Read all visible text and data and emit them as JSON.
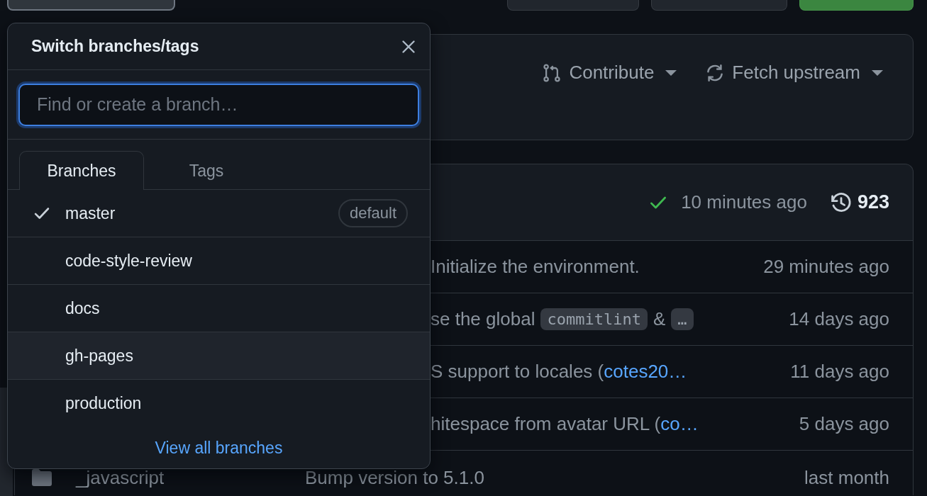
{
  "top_buttons": [
    {
      "kind": "outlined"
    },
    {
      "kind": "default"
    },
    {
      "kind": "default"
    },
    {
      "kind": "primary"
    }
  ],
  "repo_actions": [
    {
      "label": "Contribute",
      "kind": "contribute"
    },
    {
      "label": "Fetch upstream",
      "kind": "fetch"
    }
  ],
  "latest_commit": {
    "checks_passed": true,
    "time": "10 minutes ago",
    "commit_count": "923"
  },
  "files": [
    {
      "message": [
        {
          "kind": "text",
          "text": "Initialize the environment."
        }
      ],
      "time": "29 minutes ago"
    },
    {
      "message": [
        {
          "kind": "text",
          "text": "se the global"
        },
        {
          "kind": "code",
          "text": "commitlint"
        },
        {
          "kind": "text",
          "text": "&"
        },
        {
          "kind": "code",
          "text": "…"
        }
      ],
      "time": "14 days ago"
    },
    {
      "message": [
        {
          "kind": "text",
          "text": "S support to locales ("
        },
        {
          "kind": "link",
          "text": "cotes20…"
        }
      ],
      "time": "11 days ago"
    },
    {
      "message": [
        {
          "kind": "text",
          "text": "hitespace from avatar URL ("
        },
        {
          "kind": "link",
          "text": "co…"
        }
      ],
      "time": "5 days ago"
    },
    {
      "kind": "folder",
      "name": "_javascript",
      "message": [
        {
          "kind": "text",
          "text": "Bump version to 5.1.0"
        }
      ],
      "time": "last month"
    }
  ],
  "branch_menu": {
    "title": "Switch branches/tags",
    "filter": {
      "placeholder": "Find or create a branch…"
    },
    "tabs": [
      {
        "label": "Branches",
        "selected": true
      },
      {
        "label": "Tags",
        "selected": false
      }
    ],
    "items": [
      {
        "name": "master",
        "checked": true,
        "badge": "default",
        "hovered": false
      },
      {
        "name": "code-style-review",
        "checked": false,
        "hovered": false
      },
      {
        "name": "docs",
        "checked": false,
        "hovered": false
      },
      {
        "name": "gh-pages",
        "checked": false,
        "hovered": true
      },
      {
        "name": "production",
        "checked": false,
        "hovered": false
      }
    ],
    "footer_link": "View all branches"
  }
}
